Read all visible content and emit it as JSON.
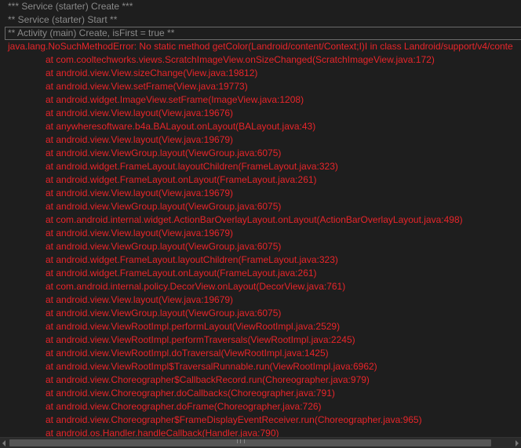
{
  "log": {
    "lines": [
      {
        "kind": "info",
        "text": "*** Service (starter) Create ***"
      },
      {
        "kind": "info",
        "text": "** Service (starter) Start **"
      },
      {
        "kind": "highlight",
        "text": "** Activity (main) Create, isFirst = true **"
      },
      {
        "kind": "error",
        "text": "java.lang.NoSuchMethodError: No static method getColor(Landroid/content/Context;I)I in class Landroid/support/v4/conte"
      },
      {
        "kind": "frame",
        "text": "at com.cooltechworks.views.ScratchImageView.onSizeChanged(ScratchImageView.java:172)"
      },
      {
        "kind": "frame",
        "text": "at android.view.View.sizeChange(View.java:19812)"
      },
      {
        "kind": "frame",
        "text": "at android.view.View.setFrame(View.java:19773)"
      },
      {
        "kind": "frame",
        "text": "at android.widget.ImageView.setFrame(ImageView.java:1208)"
      },
      {
        "kind": "frame",
        "text": "at android.view.View.layout(View.java:19676)"
      },
      {
        "kind": "frame",
        "text": "at anywheresoftware.b4a.BALayout.onLayout(BALayout.java:43)"
      },
      {
        "kind": "frame",
        "text": "at android.view.View.layout(View.java:19679)"
      },
      {
        "kind": "frame",
        "text": "at android.view.ViewGroup.layout(ViewGroup.java:6075)"
      },
      {
        "kind": "frame",
        "text": "at android.widget.FrameLayout.layoutChildren(FrameLayout.java:323)"
      },
      {
        "kind": "frame",
        "text": "at android.widget.FrameLayout.onLayout(FrameLayout.java:261)"
      },
      {
        "kind": "frame",
        "text": "at android.view.View.layout(View.java:19679)"
      },
      {
        "kind": "frame",
        "text": "at android.view.ViewGroup.layout(ViewGroup.java:6075)"
      },
      {
        "kind": "frame",
        "text": "at com.android.internal.widget.ActionBarOverlayLayout.onLayout(ActionBarOverlayLayout.java:498)"
      },
      {
        "kind": "frame",
        "text": "at android.view.View.layout(View.java:19679)"
      },
      {
        "kind": "frame",
        "text": "at android.view.ViewGroup.layout(ViewGroup.java:6075)"
      },
      {
        "kind": "frame",
        "text": "at android.widget.FrameLayout.layoutChildren(FrameLayout.java:323)"
      },
      {
        "kind": "frame",
        "text": "at android.widget.FrameLayout.onLayout(FrameLayout.java:261)"
      },
      {
        "kind": "frame",
        "text": "at com.android.internal.policy.DecorView.onLayout(DecorView.java:761)"
      },
      {
        "kind": "frame",
        "text": "at android.view.View.layout(View.java:19679)"
      },
      {
        "kind": "frame",
        "text": "at android.view.ViewGroup.layout(ViewGroup.java:6075)"
      },
      {
        "kind": "frame",
        "text": "at android.view.ViewRootImpl.performLayout(ViewRootImpl.java:2529)"
      },
      {
        "kind": "frame",
        "text": "at android.view.ViewRootImpl.performTraversals(ViewRootImpl.java:2245)"
      },
      {
        "kind": "frame",
        "text": "at android.view.ViewRootImpl.doTraversal(ViewRootImpl.java:1425)"
      },
      {
        "kind": "frame",
        "text": "at android.view.ViewRootImpl$TraversalRunnable.run(ViewRootImpl.java:6962)"
      },
      {
        "kind": "frame",
        "text": "at android.view.Choreographer$CallbackRecord.run(Choreographer.java:979)"
      },
      {
        "kind": "frame",
        "text": "at android.view.Choreographer.doCallbacks(Choreographer.java:791)"
      },
      {
        "kind": "frame",
        "text": "at android.view.Choreographer.doFrame(Choreographer.java:726)"
      },
      {
        "kind": "frame",
        "text": "at android.view.Choreographer$FrameDisplayEventReceiver.run(Choreographer.java:965)"
      },
      {
        "kind": "frame",
        "text": "at android.os.Handler.handleCallback(Handler.java:790)"
      }
    ]
  },
  "scrollbar": {
    "left_icon": "arrow-left-icon",
    "right_icon": "arrow-right-icon",
    "grip_icon": "grip-icon"
  },
  "colors": {
    "background": "#1e1e1e",
    "info_text": "#8a8a8a",
    "error_text": "#e8252a"
  }
}
